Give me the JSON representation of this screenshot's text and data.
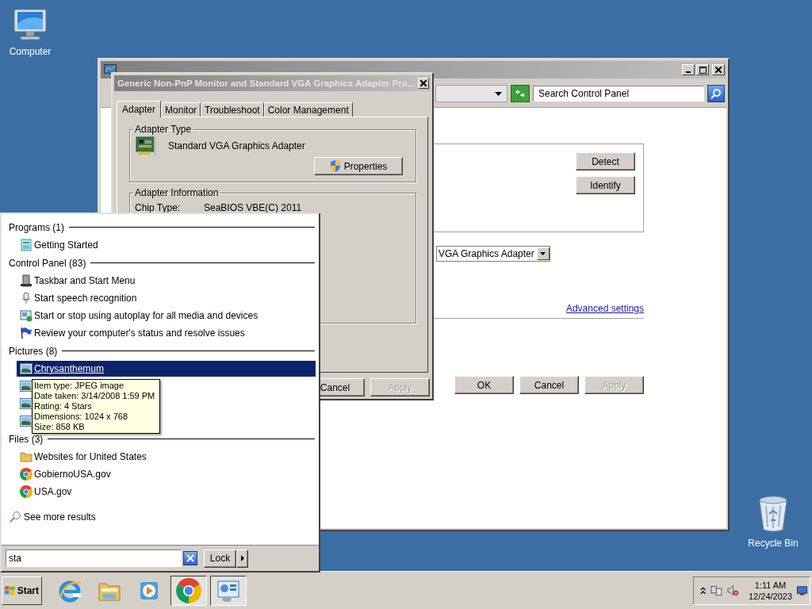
{
  "desktop_icons": [
    {
      "kind": "computer",
      "label": "Computer"
    },
    {
      "kind": "recycle-bin",
      "label": "Recycle Bin"
    }
  ],
  "control_panel_window": {
    "search": {
      "placeholder": "Search Control Panel"
    },
    "display_buttons": [
      "Detect",
      "Identify"
    ],
    "display_dropdown": {
      "value": "VGA Graphics Adapter"
    },
    "link": "Advanced settings",
    "buttons": [
      {
        "label": "OK",
        "disabled": false
      },
      {
        "label": "Cancel",
        "disabled": false
      },
      {
        "label": "Apply",
        "disabled": true
      }
    ]
  },
  "properties_dialog": {
    "title": "Generic Non-PnP Monitor and Standard VGA Graphics Adapter Pro...",
    "tabs": [
      {
        "label": "Adapter",
        "selected": true
      },
      {
        "label": "Monitor",
        "selected": false
      },
      {
        "label": "Troubleshoot",
        "selected": false
      },
      {
        "label": "Color Management",
        "selected": false
      }
    ],
    "adapter_type": {
      "heading": "Adapter Type",
      "name": "Standard VGA Graphics Adapter",
      "button": "Properties"
    },
    "adapter_info": {
      "heading": "Adapter Information",
      "rows": [
        {
          "label": "Chip Type:",
          "value": "SeaBIOS VBE(C) 2011"
        }
      ]
    },
    "buttons": [
      {
        "label": "Cancel",
        "disabled": false
      },
      {
        "label": "Apply",
        "disabled": true
      }
    ]
  },
  "start_menu": {
    "groups": [
      {
        "heading": "Programs (1)",
        "items": [
          {
            "kind": "app",
            "label": "Getting Started",
            "selected": false
          }
        ]
      },
      {
        "heading": "Control Panel (83)",
        "items": [
          {
            "kind": "taskbar",
            "label": "Taskbar and Start Menu",
            "selected": false
          },
          {
            "kind": "mic",
            "label": "Start speech recognition",
            "selected": false
          },
          {
            "kind": "autoplay",
            "label": "Start or stop using autoplay for all media and devices",
            "selected": false
          },
          {
            "kind": "flag",
            "label": "Review your computer's status and resolve issues",
            "selected": false
          }
        ]
      },
      {
        "heading": "Pictures (8)",
        "items": [
          {
            "kind": "image",
            "label": "Chrysanthemum",
            "selected": true
          },
          {
            "kind": "image",
            "selected": false
          },
          {
            "kind": "image",
            "selected": false
          },
          {
            "kind": "image",
            "selected": false
          }
        ]
      },
      {
        "heading": "Files (3)",
        "items": [
          {
            "kind": "folder",
            "label": "Websites for United States",
            "selected": false
          },
          {
            "kind": "chrome",
            "label": "GobiernoUSA.gov",
            "selected": false
          },
          {
            "kind": "chrome",
            "label": "USA.gov",
            "selected": false
          }
        ]
      }
    ],
    "see_more": "See more results",
    "search": {
      "value": "sta"
    },
    "lock_button": "Lock"
  },
  "tooltip": {
    "lines": [
      "Item type: JPEG image",
      "Date taken: 3/14/2008 1:59 PM",
      "Rating: 4 Stars",
      "Dimensions: 1024 x 768",
      "Size: 858 KB"
    ]
  },
  "taskbar": {
    "start": "Start",
    "pinned": [
      {
        "kind": "internet-explorer",
        "running": false
      },
      {
        "kind": "file-explorer",
        "running": false
      },
      {
        "kind": "media-player",
        "running": false
      },
      {
        "kind": "chrome",
        "running": true
      },
      {
        "kind": "control-panel",
        "running": true
      }
    ],
    "clock": {
      "time": "1:11 AM",
      "date": "12/24/2023"
    }
  }
}
